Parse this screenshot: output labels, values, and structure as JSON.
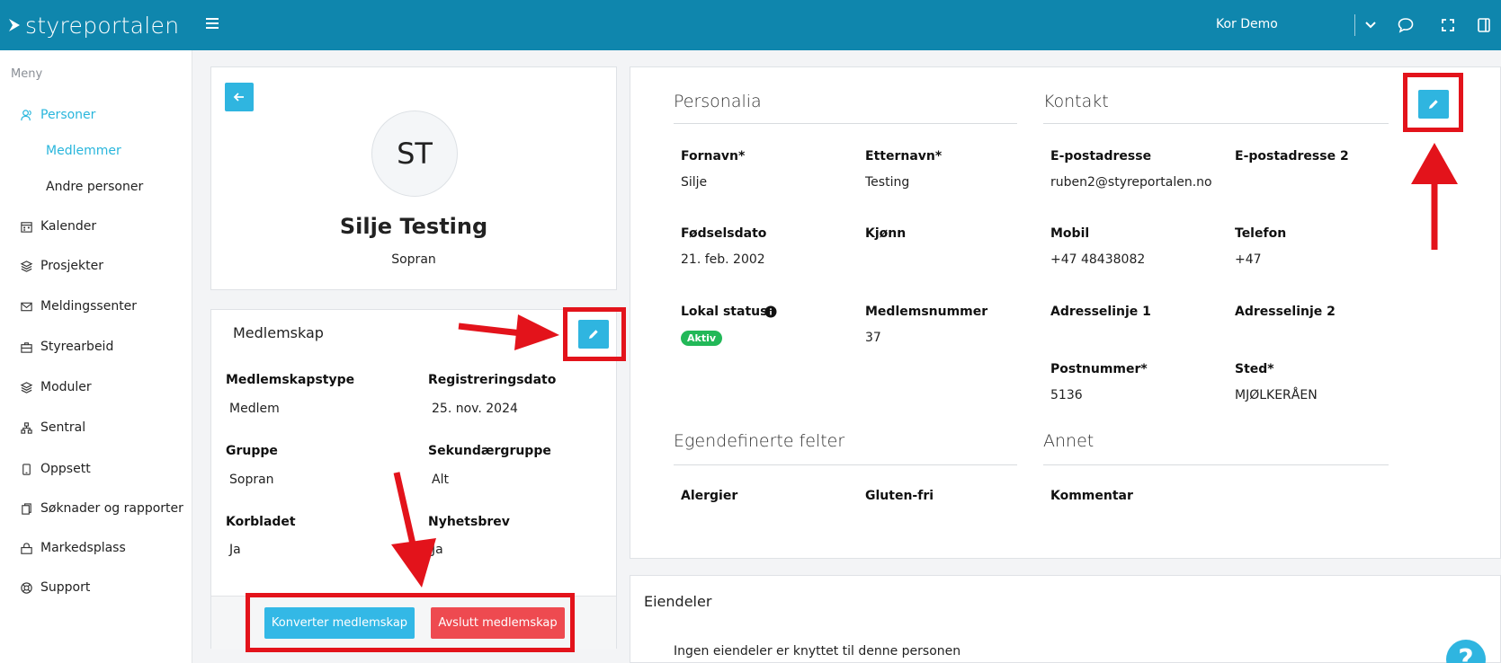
{
  "app": {
    "logo_text": "styreportalen",
    "user_name": "Kor Demo"
  },
  "sidebar": {
    "title": "Meny",
    "items": [
      {
        "label": "Personer",
        "icon": "users-icon",
        "active": true
      },
      {
        "label": "Medlemmer",
        "sub": true,
        "active": true
      },
      {
        "label": "Andre personer",
        "sub": true
      },
      {
        "label": "Kalender",
        "icon": "calendar-icon"
      },
      {
        "label": "Prosjekter",
        "icon": "layers-icon"
      },
      {
        "label": "Meldingssenter",
        "icon": "mail-icon"
      },
      {
        "label": "Styrearbeid",
        "icon": "briefcase-icon"
      },
      {
        "label": "Moduler",
        "icon": "layers-icon"
      },
      {
        "label": "Sentral",
        "icon": "sitemap-icon"
      },
      {
        "label": "Oppsett",
        "icon": "tablet-icon"
      },
      {
        "label": "Søknader og rapporter",
        "icon": "documents-icon"
      },
      {
        "label": "Markedsplass",
        "icon": "shop-icon"
      },
      {
        "label": "Support",
        "icon": "lifebuoy-icon"
      }
    ]
  },
  "profile": {
    "initials": "ST",
    "name": "Silje Testing",
    "group": "Sopran"
  },
  "membership": {
    "heading": "Medlemskap",
    "fields": [
      {
        "label": "Medlemskapstype",
        "value": "Medlem"
      },
      {
        "label": "Registreringsdato",
        "value": "25. nov. 2024"
      },
      {
        "label": "Gruppe",
        "value": "Sopran"
      },
      {
        "label": "Sekundærgruppe",
        "value": "Alt"
      },
      {
        "label": "Korbladet",
        "value": "Ja"
      },
      {
        "label": "Nyhetsbrev",
        "value": "Ja"
      }
    ],
    "convert_label": "Konverter medlemskap",
    "end_label": "Avslutt medlemskap"
  },
  "personalia": {
    "heading": "Personalia",
    "first_name_label": "Fornavn*",
    "first_name": "Silje",
    "last_name_label": "Etternavn*",
    "last_name": "Testing",
    "birth_label": "Fødselsdato",
    "birth": "21. feb. 2002",
    "gender_label": "Kjønn",
    "status_label": "Lokal status*",
    "status": "Aktiv",
    "member_no_label": "Medlemsnummer",
    "member_no": "37"
  },
  "contact": {
    "heading": "Kontakt",
    "email_label": "E-postadresse",
    "email": "ruben2@styreportalen.no",
    "email2_label": "E-postadresse 2",
    "mobile_label": "Mobil",
    "mobile": "+47 48438082",
    "phone_label": "Telefon",
    "phone": "+47",
    "address1_label": "Adresselinje 1",
    "address2_label": "Adresselinje 2",
    "postal_label": "Postnummer*",
    "postal": "5136",
    "city_label": "Sted*",
    "city": "MJØLKERÅEN"
  },
  "custom": {
    "heading": "Egendefinerte felter",
    "allergy_label": "Alergier",
    "gluten_label": "Gluten-fri"
  },
  "other": {
    "heading": "Annet",
    "comment_label": "Kommentar"
  },
  "assets": {
    "heading": "Eiendeler",
    "empty_text": "Ingen eiendeler er knyttet til denne personen"
  },
  "help": {
    "label": "?"
  },
  "colors": {
    "topbar": "#0f86ad",
    "accent": "#2fb5e0",
    "danger": "#ee4a50",
    "success": "#22b858",
    "annotation": "#e3131b"
  }
}
